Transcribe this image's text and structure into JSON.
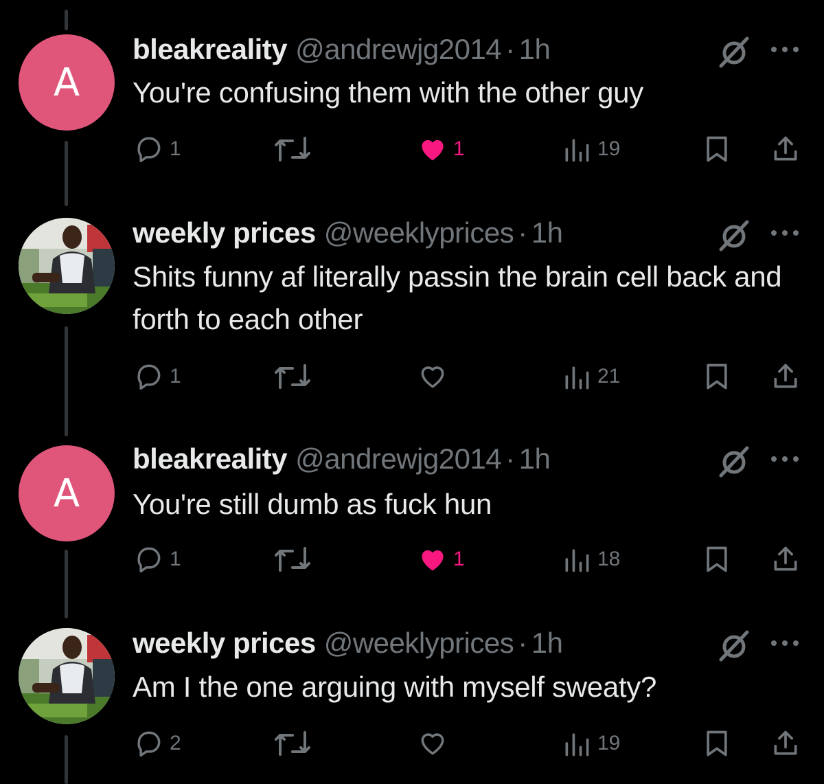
{
  "tweets": [
    {
      "avatar_letter": "A",
      "name": "bleakreality",
      "handle": "@andrewjg2014",
      "separator": "·",
      "time": "1h",
      "text": "You're confusing them with the other guy",
      "replies": "1",
      "retweets": "",
      "likes": "1",
      "liked": true,
      "views": "19"
    },
    {
      "avatar_letter": "",
      "name": "weekly prices",
      "handle": "@weeklyprices",
      "separator": "·",
      "time": "1h",
      "text": "Shits funny af literally passin the brain cell back and forth to each other",
      "replies": "1",
      "retweets": "",
      "likes": "",
      "liked": false,
      "views": "21"
    },
    {
      "avatar_letter": "A",
      "name": "bleakreality",
      "handle": "@andrewjg2014",
      "separator": "·",
      "time": "1h",
      "text": "You're still dumb as fuck hun",
      "replies": "1",
      "retweets": "",
      "likes": "1",
      "liked": true,
      "views": "18"
    },
    {
      "avatar_letter": "",
      "name": "weekly prices",
      "handle": "@weeklyprices",
      "separator": "·",
      "time": "1h",
      "text": "Am I the one arguing with myself sweaty?",
      "replies": "2",
      "retweets": "",
      "likes": "",
      "liked": false,
      "views": "19"
    }
  ],
  "colors": {
    "background": "#000000",
    "text": "#e7e9ea",
    "muted": "#71767b",
    "like_active": "#f91880",
    "avatar_pink": "#e0567a",
    "thread_line": "#333639"
  },
  "icons": {
    "reply": "reply-icon",
    "retweet": "retweet-icon",
    "like": "heart-icon",
    "views": "views-icon",
    "bookmark": "bookmark-icon",
    "share": "share-icon",
    "grok": "grok-icon",
    "more": "more-icon"
  }
}
